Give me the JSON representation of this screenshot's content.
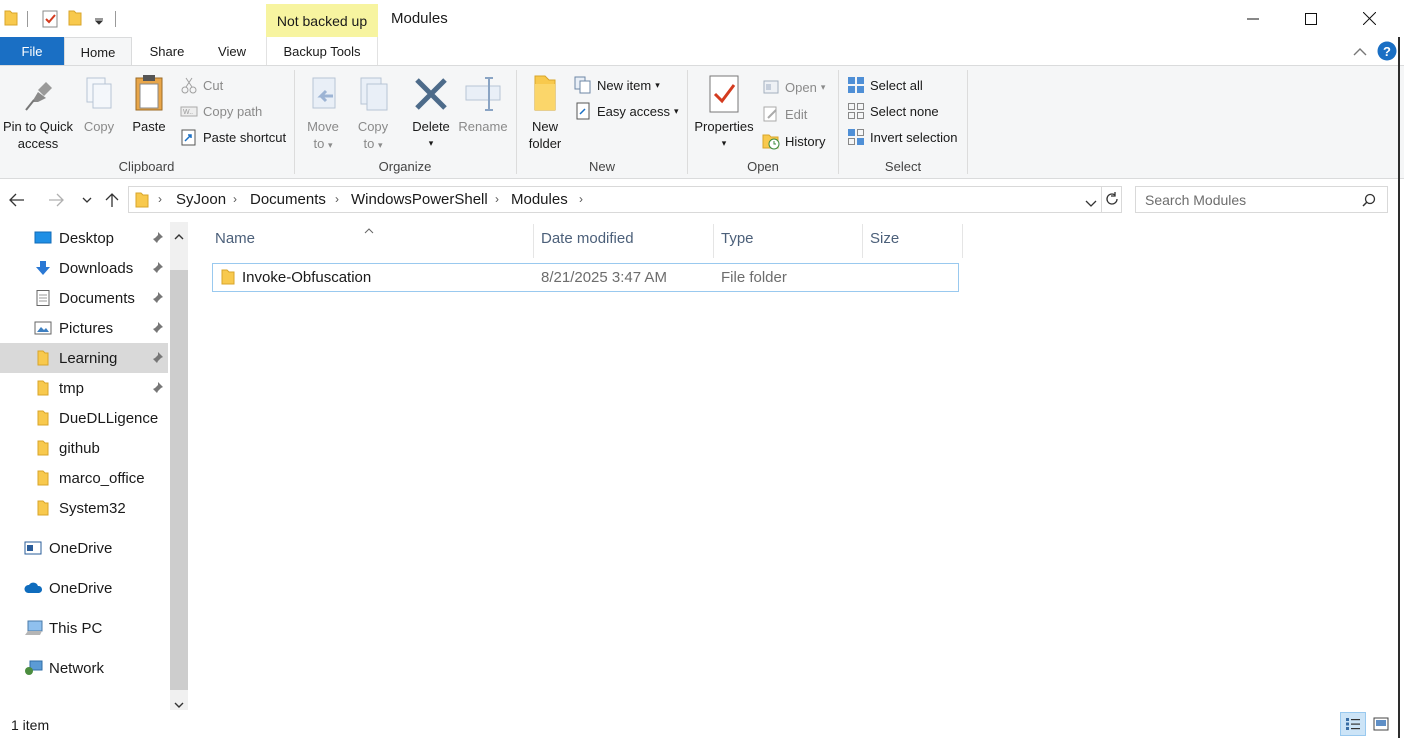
{
  "window": {
    "title": "Modules",
    "context_tab_label": "Not backed up",
    "minimize_label": "Minimize",
    "maximize_label": "Maximize",
    "close_label": "Close"
  },
  "tabs": {
    "file": "File",
    "home": "Home",
    "share": "Share",
    "view": "View",
    "backup_tools": "Backup Tools"
  },
  "ribbon": {
    "clipboard": {
      "group_label": "Clipboard",
      "pin_line1": "Pin to Quick",
      "pin_line2": "access",
      "copy": "Copy",
      "paste": "Paste",
      "cut": "Cut",
      "copy_path": "Copy path",
      "paste_shortcut": "Paste shortcut"
    },
    "organize": {
      "group_label": "Organize",
      "move_to_line1": "Move",
      "move_to_line2": "to",
      "copy_to_line1": "Copy",
      "copy_to_line2": "to",
      "delete": "Delete",
      "rename": "Rename"
    },
    "new": {
      "group_label": "New",
      "new_folder_line1": "New",
      "new_folder_line2": "folder",
      "new_item": "New item",
      "easy_access": "Easy access"
    },
    "open": {
      "group_label": "Open",
      "properties": "Properties",
      "open": "Open",
      "edit": "Edit",
      "history": "History"
    },
    "select": {
      "group_label": "Select",
      "select_all": "Select all",
      "select_none": "Select none",
      "invert_selection": "Invert selection"
    }
  },
  "address": {
    "breadcrumbs": [
      "SyJoon",
      "Documents",
      "WindowsPowerShell",
      "Modules"
    ],
    "search_placeholder": "Search Modules"
  },
  "nav": {
    "quick_access": [
      {
        "label": "Desktop",
        "icon": "desktop-icon",
        "pinned": true
      },
      {
        "label": "Downloads",
        "icon": "downloads-icon",
        "pinned": true
      },
      {
        "label": "Documents",
        "icon": "documents-icon",
        "pinned": true
      },
      {
        "label": "Pictures",
        "icon": "pictures-icon",
        "pinned": true
      },
      {
        "label": "Learning",
        "icon": "folder-icon",
        "pinned": true,
        "selected": true
      },
      {
        "label": "tmp",
        "icon": "folder-icon",
        "pinned": true
      },
      {
        "label": "DueDLLigence",
        "icon": "folder-icon"
      },
      {
        "label": "github",
        "icon": "folder-icon"
      },
      {
        "label": "marco_office",
        "icon": "folder-icon"
      },
      {
        "label": "System32",
        "icon": "folder-icon"
      }
    ],
    "roots": [
      {
        "label": "OneDrive",
        "icon": "onedrive-business-icon"
      },
      {
        "label": "OneDrive",
        "icon": "onedrive-cloud-icon"
      },
      {
        "label": "This PC",
        "icon": "this-pc-icon"
      },
      {
        "label": "Network",
        "icon": "network-icon"
      }
    ]
  },
  "list": {
    "columns": [
      "Name",
      "Date modified",
      "Type",
      "Size"
    ],
    "rows": [
      {
        "name": "Invoke-Obfuscation",
        "date_modified": "8/21/2025 3:47 AM",
        "type": "File folder",
        "size": ""
      }
    ]
  },
  "status": {
    "item_count": "1 item"
  },
  "colors": {
    "accent": "#1a6fc4",
    "context_tab": "#f7f4a0",
    "folder": "#f8c94d",
    "selection_border": "#99c9ef"
  }
}
